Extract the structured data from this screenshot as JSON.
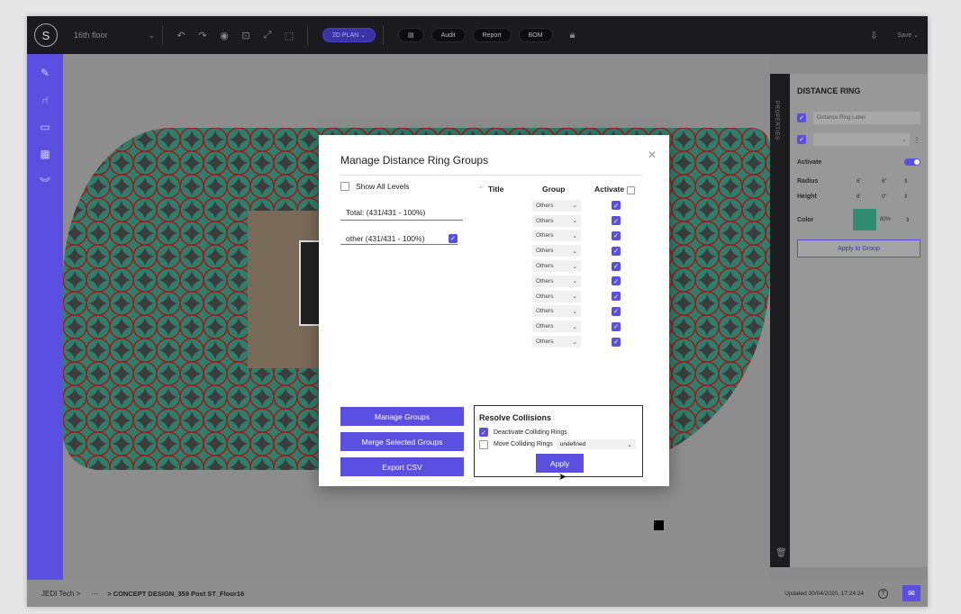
{
  "topbar": {
    "logo": "S",
    "floor": "16th floor",
    "mode_pill": "2D PLAN",
    "audit": "Audit",
    "report": "Report",
    "bom": "BOM",
    "save": "Save"
  },
  "properties_rail": {
    "label": "PROPERTIES"
  },
  "properties": {
    "title": "DISTANCE RING",
    "label_placeholder": "Distance Ring Label",
    "activate_label": "Activate",
    "radius_label": "Radius",
    "radius_ft": "6'",
    "radius_in": "6\"",
    "height_label": "Height",
    "height_ft": "6'",
    "height_in": "0\"",
    "color_label": "Color",
    "color_value": "#2f8c70",
    "opacity": "80%",
    "apply_group": "Apply to Group"
  },
  "bottombar": {
    "crumb": "JEDI Tech >",
    "dots": "···",
    "project": "> CONCEPT DESIGN_359 Post ST_Floor16",
    "updated": "Updated 30/04/2020, 17:24:24",
    "help": "?"
  },
  "dialog": {
    "title": "Manage Distance Ring Groups",
    "show_all": "Show All Levels",
    "total": "Total: (431/431 - 100%)",
    "other": "other (431/431 - 100%)",
    "col_title": "Title",
    "col_group": "Group",
    "col_activate": "Activate",
    "rows": [
      {
        "group": "Others"
      },
      {
        "group": "Others"
      },
      {
        "group": "Others"
      },
      {
        "group": "Others"
      },
      {
        "group": "Others"
      },
      {
        "group": "Others"
      },
      {
        "group": "Others"
      },
      {
        "group": "Others"
      },
      {
        "group": "Others"
      },
      {
        "group": "Others"
      }
    ],
    "manage_groups": "Manage Groups",
    "merge_groups": "Merge Selected Groups",
    "export_csv": "Export CSV",
    "resolve": {
      "title": "Resolve Collisions",
      "deactivate": "Deactivate Colliding Rings",
      "move": "Move Colliding Rings",
      "move_option": "undefined",
      "apply": "Apply"
    }
  },
  "colors": {
    "accent": "#5a4fe0",
    "ring_fill": "#2f7e6b",
    "ring_stroke": "#a11818"
  }
}
